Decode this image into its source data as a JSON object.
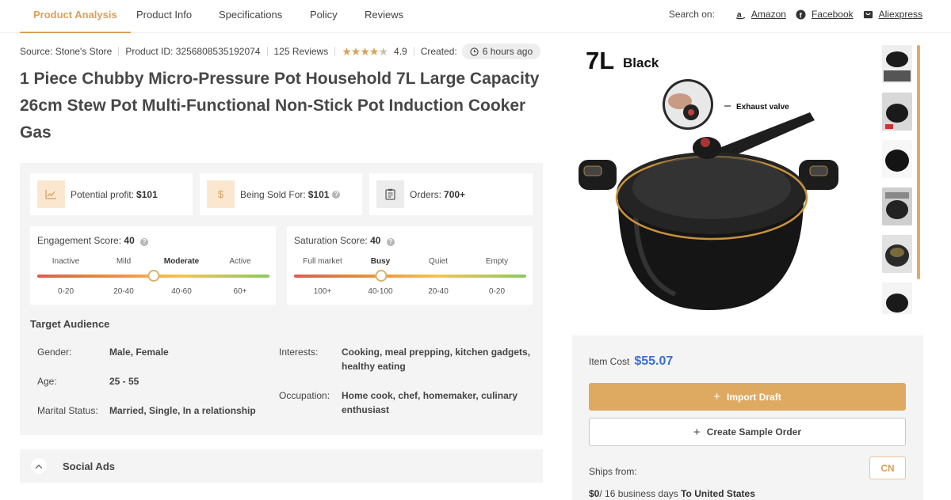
{
  "nav": {
    "tabs": [
      {
        "label": "Product Analysis"
      },
      {
        "label": "Product Info"
      },
      {
        "label": "Specifications"
      },
      {
        "label": "Policy"
      },
      {
        "label": "Reviews"
      }
    ],
    "search_on_label": "Search on:",
    "search_links": [
      {
        "label": "Amazon",
        "icon": "amazon-icon"
      },
      {
        "label": "Facebook",
        "icon": "facebook-icon"
      },
      {
        "label": "Aliexpress",
        "icon": "aliexpress-icon"
      }
    ]
  },
  "meta": {
    "source": "Source: Stone's Store",
    "product_id": "Product ID: 3256808535192074",
    "reviews": "125 Reviews",
    "rating_stars": 4.5,
    "rating": "4.9",
    "created_label": "Created:",
    "created_value": "6 hours ago"
  },
  "product": {
    "title": "1 Piece Chubby Micro-Pressure Pot Household 7L Large Capacity 26cm Stew Pot Multi-Functional Non-Stick Pot Induction Cooker Gas"
  },
  "stats": {
    "profit_label": "Potential profit:",
    "profit_value": "$101",
    "sold_label": "Being Sold For:",
    "sold_value": "$101",
    "orders_label": "Orders:",
    "orders_value": "700+",
    "dollar_glyph": "$"
  },
  "engagement": {
    "title": "Engagement Score:",
    "score": "40",
    "level": 0.5,
    "levels": [
      "Inactive",
      "Mild",
      "Moderate",
      "Active"
    ],
    "active_index": 2,
    "ranges": [
      "0-20",
      "20-40",
      "40-60",
      "60+"
    ]
  },
  "saturation": {
    "title": "Saturation Score:",
    "score": "40",
    "level": 0.375,
    "levels": [
      "Full market",
      "Busy",
      "Quiet",
      "Empty"
    ],
    "active_index": 1,
    "ranges": [
      "100+",
      "40-100",
      "20-40",
      "0-20"
    ]
  },
  "audience": {
    "title": "Target Audience",
    "gender_label": "Gender:",
    "gender": "Male, Female",
    "age_label": "Age:",
    "age": "25 - 55",
    "marital_label": "Marital Status:",
    "marital": "Married, Single, In a relationship",
    "interests_label": "Interests:",
    "interests": "Cooking, meal prepping, kitchen gadgets, healthy eating",
    "occupation_label": "Occupation:",
    "occupation": "Home cook, chef, homemaker, culinary enthusiast"
  },
  "social_ads": {
    "label": "Social Ads"
  },
  "image": {
    "size_label": "7L",
    "color_label": "Black",
    "callout": "Exhaust valve"
  },
  "pricing": {
    "item_cost_label": "Item Cost",
    "item_cost": "$55.07",
    "import_label": "Import Draft",
    "sample_label": "Create Sample Order",
    "ships_from_label": "Ships from:",
    "ships_from": "CN",
    "shipping_cost": "$0",
    "shipping_days": "/ 16 business days",
    "shipping_dest": "To United States"
  },
  "colors": {
    "accent": "#d9a15a",
    "price_blue": "#3a6fcf"
  }
}
